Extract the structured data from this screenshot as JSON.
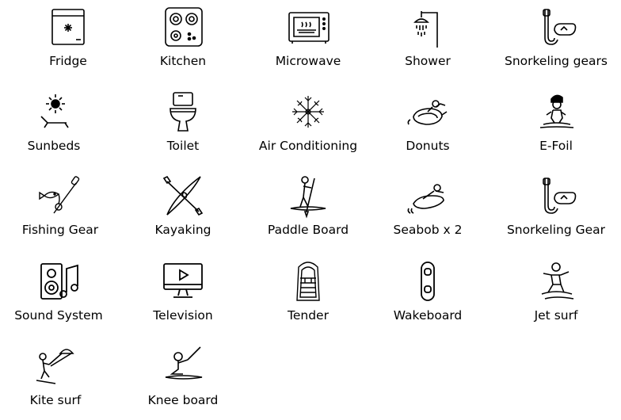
{
  "amenities": [
    {
      "label": "Fridge",
      "icon": "fridge-icon"
    },
    {
      "label": "Kitchen",
      "icon": "stove-icon"
    },
    {
      "label": "Microwave",
      "icon": "microwave-icon"
    },
    {
      "label": "Shower",
      "icon": "shower-icon"
    },
    {
      "label": "Snorkeling gears",
      "icon": "snorkel-mask-icon"
    },
    {
      "label": "Sunbeds",
      "icon": "sunbed-icon"
    },
    {
      "label": "Toilet",
      "icon": "toilet-icon"
    },
    {
      "label": "Air Conditioning",
      "icon": "snowflake-icon"
    },
    {
      "label": "Donuts",
      "icon": "towable-donut-icon"
    },
    {
      "label": "E-Foil",
      "icon": "efoil-rider-icon"
    },
    {
      "label": "Fishing Gear",
      "icon": "fishing-rod-icon"
    },
    {
      "label": "Kayaking",
      "icon": "kayak-icon"
    },
    {
      "label": "Paddle Board",
      "icon": "paddle-board-icon"
    },
    {
      "label": "Seabob x 2",
      "icon": "seabob-icon"
    },
    {
      "label": "Snorkeling Gear",
      "icon": "snorkel-mask-icon"
    },
    {
      "label": "Sound System",
      "icon": "speaker-icon"
    },
    {
      "label": "Television",
      "icon": "television-icon"
    },
    {
      "label": "Tender",
      "icon": "tender-boat-icon"
    },
    {
      "label": "Wakeboard",
      "icon": "wakeboard-icon"
    },
    {
      "label": "Jet surf",
      "icon": "jet-surf-icon"
    },
    {
      "label": "Kite surf",
      "icon": "kite-surf-icon"
    },
    {
      "label": "Knee board",
      "icon": "knee-board-icon"
    }
  ]
}
